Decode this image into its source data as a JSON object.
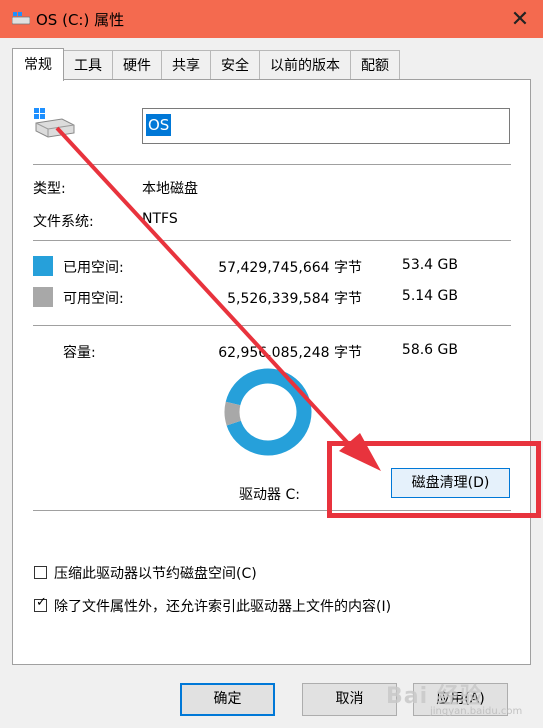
{
  "window": {
    "title": "OS (C:) 属性",
    "close": "✕"
  },
  "tabs": [
    {
      "label": "常规",
      "active": true
    },
    {
      "label": "工具"
    },
    {
      "label": "硬件"
    },
    {
      "label": "共享"
    },
    {
      "label": "安全"
    },
    {
      "label": "以前的版本"
    },
    {
      "label": "配额"
    }
  ],
  "drive": {
    "name": "OS"
  },
  "info": {
    "type_label": "类型:",
    "type_value": "本地磁盘",
    "fs_label": "文件系统:",
    "fs_value": "NTFS"
  },
  "usage": {
    "used_label": "已用空间:",
    "used_bytes": "57,429,745,664 字节",
    "used_size": "53.4 GB",
    "free_label": "可用空间:",
    "free_bytes": "5,526,339,584 字节",
    "free_size": "5.14 GB",
    "capacity_label": "容量:",
    "capacity_bytes": "62,956,085,248 字节",
    "capacity_size": "58.6 GB",
    "used_fraction": 0.912,
    "used_color": "#26a0da",
    "free_color": "#a8a8a8"
  },
  "drive_label": "驱动器 C:",
  "clean_button": "磁盘清理(D)",
  "options": [
    {
      "label": "压缩此驱动器以节约磁盘空间(C)",
      "checked": false
    },
    {
      "label": "除了文件属性外，还允许索引此驱动器上文件的内容(I)",
      "checked": true
    }
  ],
  "buttons": {
    "ok": "确定",
    "cancel": "取消",
    "apply": "应用(A)"
  },
  "watermark": {
    "main": "Bai 经验",
    "sub": "jingyan.baidu.com"
  },
  "annotation_color": "#e8333d"
}
